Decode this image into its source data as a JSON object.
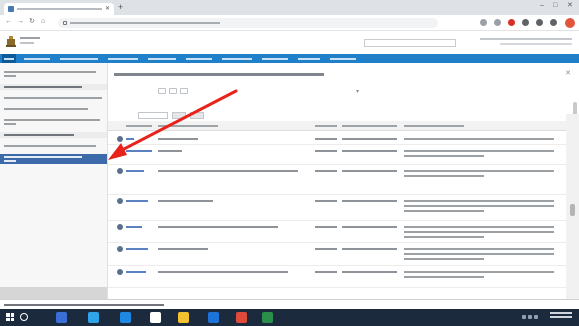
{
  "browser": {
    "tab_title": "",
    "url": "",
    "icons": {
      "back": "arrow-left-icon",
      "forward": "arrow-right-icon",
      "reload": "reload-icon",
      "home": "home-icon",
      "close": "close-icon",
      "new_tab": "plus-icon"
    },
    "extension_colors": [
      "#9aa0a6",
      "#9aa0a6",
      "#d93025",
      "#5f6368",
      "#5f6368",
      "#5f6368"
    ],
    "profile_color": "#e2553d"
  },
  "app": {
    "header_search_placeholder": "",
    "menu_items": [
      "",
      "",
      "",
      "",
      "",
      "",
      "",
      "",
      "",
      ""
    ],
    "accent_color": "#1f7fc8",
    "selected_color": "#3d6aa8"
  },
  "sidebar": {
    "items": [
      {
        "label": "",
        "lines": 2,
        "kind": "normal"
      },
      {
        "label": "",
        "lines": 1,
        "kind": "section"
      },
      {
        "label": "",
        "lines": 1,
        "kind": "normal"
      },
      {
        "label": "",
        "lines": 1,
        "kind": "normal"
      },
      {
        "label": "",
        "lines": 2,
        "kind": "normal"
      },
      {
        "label": "",
        "lines": 1,
        "kind": "section"
      },
      {
        "label": "",
        "lines": 1,
        "kind": "normal"
      },
      {
        "label": "",
        "lines": 2,
        "kind": "selected"
      }
    ]
  },
  "main": {
    "page_title": "",
    "grid": {
      "columns": [
        "",
        "",
        "",
        "",
        ""
      ],
      "rows": [
        {
          "id": "",
          "title": "",
          "status": "",
          "date": "",
          "description": ""
        },
        {
          "id": "",
          "title": "",
          "status": "",
          "date": "",
          "description": ""
        },
        {
          "id": "",
          "title": "",
          "status": "",
          "date": "",
          "description": ""
        },
        {
          "id": "",
          "title": "",
          "status": "",
          "date": "",
          "description": ""
        },
        {
          "id": "",
          "title": "",
          "status": "",
          "date": "",
          "description": ""
        },
        {
          "id": "",
          "title": "",
          "status": "",
          "date": "",
          "description": ""
        },
        {
          "id": "",
          "title": "",
          "status": "",
          "date": "",
          "description": ""
        }
      ]
    }
  },
  "statusbar": {
    "text": ""
  },
  "taskbar": {
    "app_colors": [
      "#3a6fd6",
      "#2fa4e8",
      "#1e88e5",
      "#ffffff",
      "#f2c230",
      "#1e73d8",
      "#e04a3a",
      "#2a8f4b"
    ]
  },
  "annotation": {
    "color": "#e8231c"
  }
}
